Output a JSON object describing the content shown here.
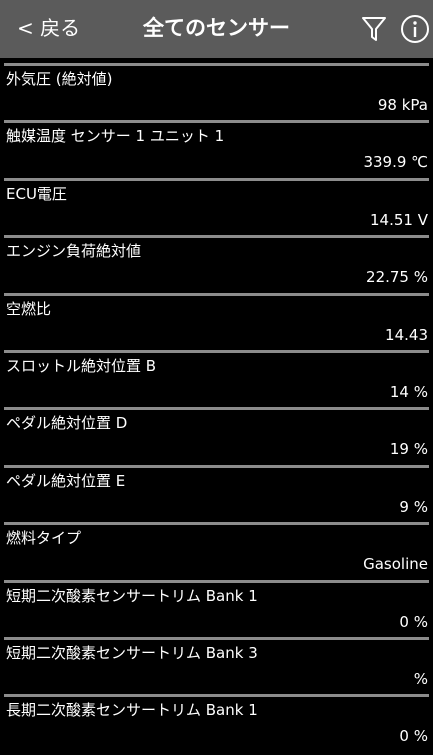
{
  "header": {
    "back_label": "< 戻る",
    "title": "全てのセンサー",
    "filter_icon": "filter-icon",
    "info_icon": "info-icon"
  },
  "sensors": [
    {
      "label": "外気圧 (絶対値)",
      "value": "98 kPa"
    },
    {
      "label": "触媒温度 センサー 1 ユニット 1",
      "value": "339.9 ℃"
    },
    {
      "label": "ECU電圧",
      "value": "14.51 V"
    },
    {
      "label": "エンジン負荷絶対値",
      "value": "22.75 %"
    },
    {
      "label": "空燃比",
      "value": "14.43"
    },
    {
      "label": "スロットル絶対位置 B",
      "value": "14 %"
    },
    {
      "label": "ペダル絶対位置 D",
      "value": "19 %"
    },
    {
      "label": "ペダル絶対位置 E",
      "value": "9 %"
    },
    {
      "label": "燃料タイプ",
      "value": "Gasoline"
    },
    {
      "label": "短期二次酸素センサートリム Bank 1",
      "value": "0 %"
    },
    {
      "label": "短期二次酸素センサートリム Bank 3",
      "value": "%"
    },
    {
      "label": "長期二次酸素センサートリム Bank 1",
      "value": "0 %"
    }
  ]
}
